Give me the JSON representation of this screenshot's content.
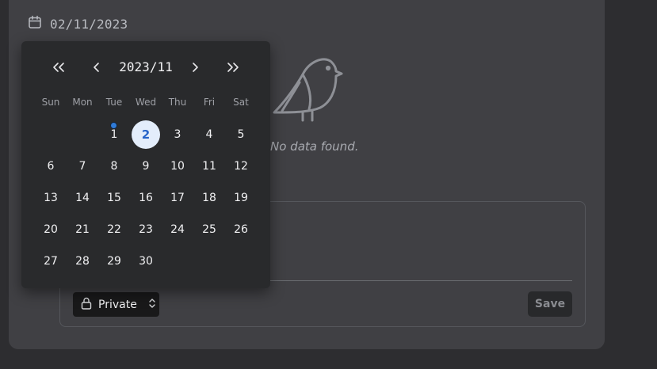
{
  "header": {
    "date": "02/11/2023",
    "icon": "calendar-icon"
  },
  "empty_state": {
    "message": "No data found."
  },
  "composer": {
    "privacy_label": "Private",
    "save_label": "Save"
  },
  "calendar": {
    "title": "2023/11",
    "weekdays": [
      "Sun",
      "Mon",
      "Tue",
      "Wed",
      "Thu",
      "Fri",
      "Sat"
    ],
    "days": [
      "",
      "",
      "1",
      "2",
      "3",
      "4",
      "5",
      "6",
      "7",
      "8",
      "9",
      "10",
      "11",
      "12",
      "13",
      "14",
      "15",
      "16",
      "17",
      "18",
      "19",
      "20",
      "21",
      "22",
      "23",
      "24",
      "25",
      "26",
      "27",
      "28",
      "29",
      "30",
      "",
      "",
      ""
    ],
    "selected_day": "2",
    "today_marker_day": "1",
    "colors": {
      "accent": "#2563c9",
      "selected_bg": "#e3edfb",
      "today_dot": "#2f7bd8"
    }
  }
}
